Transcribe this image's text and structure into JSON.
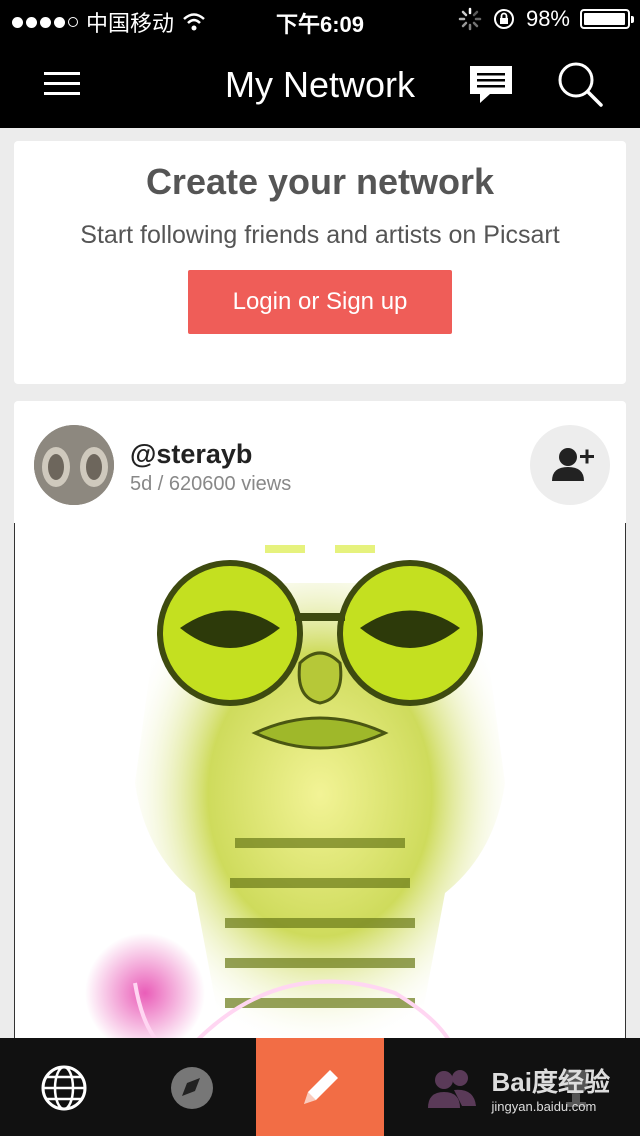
{
  "status_bar": {
    "carrier": "中国移动",
    "time": "下午6:09",
    "battery": "98%",
    "battery_level": 0.98
  },
  "nav": {
    "title": "My Network",
    "icons": [
      "menu-icon",
      "chat-icon",
      "search-icon"
    ]
  },
  "network_card": {
    "title": "Create your network",
    "subtitle": "Start following friends and artists on Picsart",
    "button_label": "Login or Sign up",
    "button_color": "#ef5d58"
  },
  "post": {
    "username": "@sterayb",
    "meta": "5d / 620600 views"
  },
  "tab_bar": {
    "tabs": [
      {
        "icon": "globe-icon"
      },
      {
        "icon": "compass-icon"
      },
      {
        "icon": "pencil-icon",
        "active": true
      },
      {
        "icon": "people-icon"
      },
      {
        "icon": "trophy-icon"
      }
    ],
    "active_color": "#f26d45"
  },
  "watermark": {
    "brand": "Bai度经验",
    "url": "jingyan.baidu.com"
  }
}
